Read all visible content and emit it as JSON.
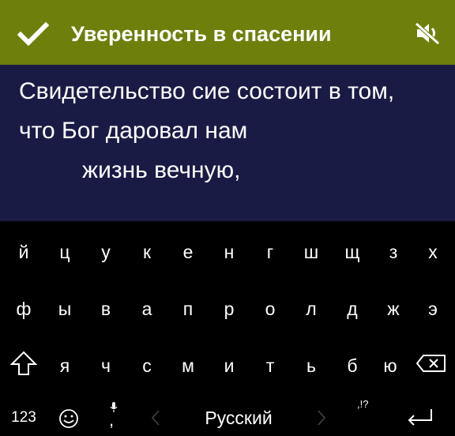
{
  "header": {
    "title": "Уверенность в спасении",
    "check_icon": "checkmark-icon",
    "mute_icon": "volume-off-icon"
  },
  "content": {
    "lines": [
      "Свидетельство сие состоит в том,",
      "что Бог даровал нам",
      "жизнь вечную,"
    ]
  },
  "keyboard": {
    "row1": [
      "й",
      "ц",
      "у",
      "к",
      "е",
      "н",
      "г",
      "ш",
      "щ",
      "з",
      "х"
    ],
    "row2": [
      "ф",
      "ы",
      "в",
      "а",
      "п",
      "р",
      "о",
      "л",
      "д",
      "ж",
      "э"
    ],
    "row3": [
      "я",
      "ч",
      "с",
      "м",
      "и",
      "т",
      "ь",
      "б",
      "ю"
    ],
    "numbers_key": "123",
    "space_label": "Русский",
    "comma_key": ",",
    "punct_hint": ",!?"
  },
  "colors": {
    "header_bg": "#6e7f0c",
    "content_bg": "#1a1b45",
    "keyboard_bg": "#000000",
    "text": "#ffffff"
  }
}
